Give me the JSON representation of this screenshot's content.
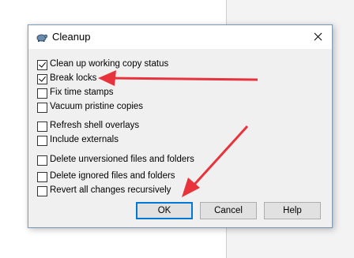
{
  "dialog": {
    "title": "Cleanup",
    "icon": "tortoise-icon",
    "options": [
      {
        "label": "Clean up working copy status",
        "checked": true
      },
      {
        "label": "Break locks",
        "checked": true
      },
      {
        "label": "Fix time stamps",
        "checked": false
      },
      {
        "label": "Vacuum pristine copies",
        "checked": false
      },
      {
        "label": "Refresh shell overlays",
        "checked": false
      },
      {
        "label": "Include externals",
        "checked": false
      },
      {
        "label": "Delete unversioned files and folders",
        "checked": false
      },
      {
        "label": "Delete ignored files and folders",
        "checked": false
      },
      {
        "label": "Revert all changes recursively",
        "checked": false
      }
    ],
    "buttons": {
      "ok": "OK",
      "cancel": "Cancel",
      "help": "Help"
    }
  },
  "annotations": {
    "arrow_color": "#e8333c"
  }
}
